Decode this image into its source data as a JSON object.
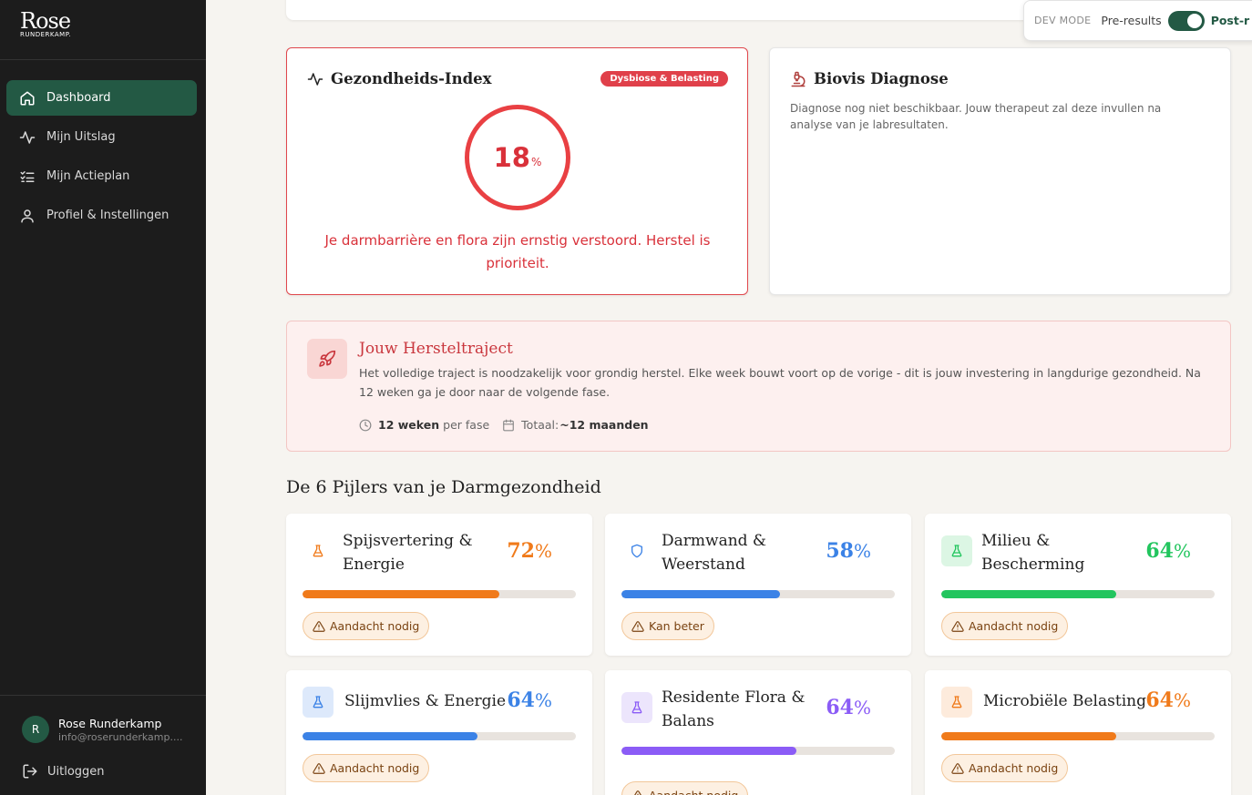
{
  "brand": {
    "name": "Rose",
    "subtitle": "RUNDERKAMP."
  },
  "nav": [
    {
      "label": "Dashboard",
      "icon": "home-icon",
      "active": true
    },
    {
      "label": "Mijn Uitslag",
      "icon": "activity-icon",
      "active": false
    },
    {
      "label": "Mijn Actieplan",
      "icon": "checklist-icon",
      "active": false
    },
    {
      "label": "Profiel & Instellingen",
      "icon": "user-icon",
      "active": false
    }
  ],
  "user": {
    "initial": "R",
    "name": "Rose Runderkamp",
    "email": "info@roserunderkamp...."
  },
  "logout": "Uitloggen",
  "dev": {
    "label": "DEV MODE",
    "pre": "Pre-results",
    "post": "Post-r",
    "toggle_on": true
  },
  "health": {
    "title": "Gezondheids-Index",
    "badge": "Dysbiose & Belasting",
    "value": "18",
    "unit": "%",
    "percent": 18,
    "message": "Je darmbarrière en flora zijn ernstig verstoord. Herstel is prioriteit."
  },
  "biovis": {
    "title": "Biovis Diagnose",
    "text": "Diagnose nog niet beschikbaar. Jouw therapeut zal deze invullen na analyse van je labresultaten."
  },
  "traject": {
    "title": "Jouw Hersteltraject",
    "text": "Het volledige traject is noodzakelijk voor grondig herstel. Elke week bouwt voort op de vorige - dit is jouw investering in langdurige gezondheid. Na 12 weken ga je door naar de volgende fase.",
    "weeks_bold": "12 weken",
    "weeks_rest": "per fase",
    "total_label": "Totaal:",
    "total_bold": "~12 maanden"
  },
  "pillars_title": "De 6 Pijlers van je Darmgezondheid",
  "pillars": [
    {
      "name": "Spijsvertering & Energie",
      "value": "72",
      "unit": "%",
      "percent": 72,
      "color": "#f07a1a",
      "icon": "flask-icon",
      "icon_bg": "#ffffff",
      "tag": "Aandacht nodig"
    },
    {
      "name": "Darmwand & Weerstand",
      "value": "58",
      "unit": "%",
      "percent": 58,
      "color": "#3b82e6",
      "icon": "shield-icon",
      "icon_bg": "#ffffff",
      "tag": "Kan beter"
    },
    {
      "name": "Milieu & Bescherming",
      "value": "64",
      "unit": "%",
      "percent": 64,
      "color": "#22c55e",
      "icon": "flask-icon",
      "icon_bg": "#dcf6e4",
      "tag": "Aandacht nodig"
    },
    {
      "name": "Slijmvlies & Energie",
      "value": "64",
      "unit": "%",
      "percent": 64,
      "color": "#3b82e6",
      "icon": "flask-icon",
      "icon_bg": "#dde9fb",
      "tag": "Aandacht nodig"
    },
    {
      "name": "Residente Flora & Balans",
      "value": "64",
      "unit": "%",
      "percent": 64,
      "color": "#8b5cf6",
      "icon": "flask-icon",
      "icon_bg": "#ece5fc",
      "tag": "Aandacht nodig"
    },
    {
      "name": "Microbiële Belasting",
      "value": "64",
      "unit": "%",
      "percent": 64,
      "color": "#f07a1a",
      "icon": "flask-icon",
      "icon_bg": "#fdebdc",
      "tag": "Aandacht nodig"
    }
  ]
}
